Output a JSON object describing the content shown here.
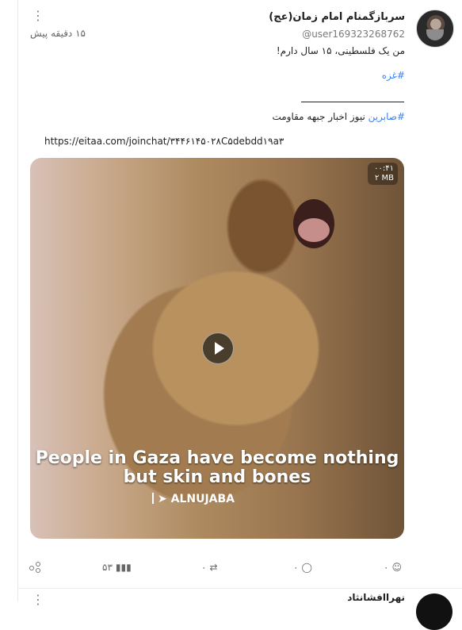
{
  "post": {
    "author_name": "سربازگمنام امام زمان(عج)",
    "handle": "@user169323268762",
    "time": "۱۵ دقیقه پیش",
    "body_line_1": "من یک فلسطینی، ۱۵ سال دارم!",
    "hashtag_gaza": "#غزه",
    "hashtag_saberin": "#صابرین",
    "news_text": " نیوز اخبار جبهه مقاومت",
    "link": "https://eitaa.com/joinchat/۳۴۴۶۱۴۵۰۲۸C۵debdd۱۹a۳"
  },
  "media": {
    "duration": "۰۰:۴۱",
    "size": "۲ MB",
    "caption_1": "People in Gaza have become nothing",
    "caption_2": "but skin and bones",
    "brand": "ALNUJABA"
  },
  "actions": {
    "views": "۵۳",
    "reposts": "۰",
    "comments": "۰",
    "reactions": "۰"
  },
  "next_post": {
    "author_name": "نهراافشانثاد"
  }
}
